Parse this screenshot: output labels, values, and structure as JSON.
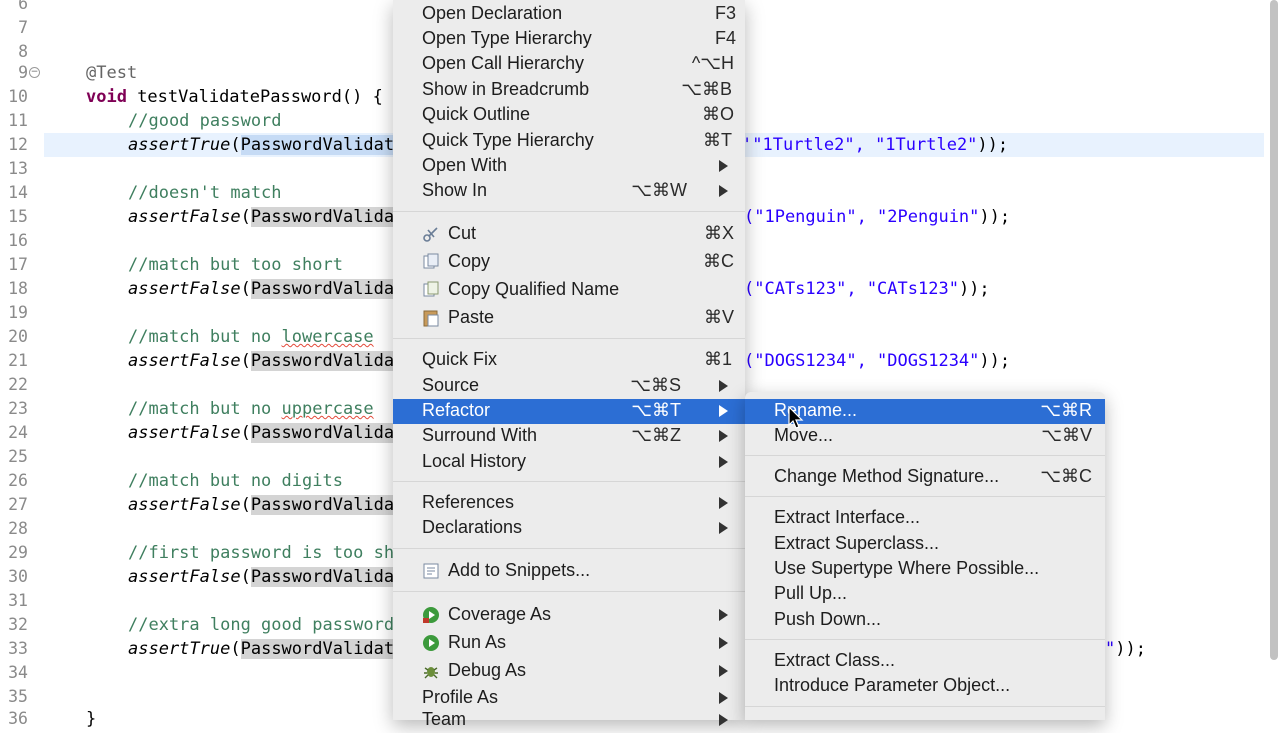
{
  "editor": {
    "lines": [
      {
        "num": "6"
      },
      {
        "num": "7"
      },
      {
        "num": "8"
      },
      {
        "num": "9",
        "annotation": "@Test"
      },
      {
        "num": "10",
        "kw": "void",
        "sig": " testValidatePassword() {"
      },
      {
        "num": "11",
        "comment": "//good password"
      },
      {
        "num": "12",
        "call": "assertTrue",
        "cls": "PasswordValidat",
        "tail_open": "(",
        "args": "\"1Turtle2\", \"1Turtle2\"",
        "end": "));"
      },
      {
        "num": "13"
      },
      {
        "num": "14",
        "comment": "//doesn't match"
      },
      {
        "num": "15",
        "call": "assertFalse",
        "cls": "PasswordValida",
        "args": "(\"1Penguin\", \"2Penguin\"",
        "end": "));"
      },
      {
        "num": "16"
      },
      {
        "num": "17",
        "comment": "//match but too short"
      },
      {
        "num": "18",
        "call": "assertFalse",
        "cls": "PasswordValida",
        "args": "(\"CATs123\", \"CATs123\"",
        "end": "));"
      },
      {
        "num": "19"
      },
      {
        "num": "20",
        "comment_a": "//match but no ",
        "comment_b": "lowercase"
      },
      {
        "num": "21",
        "call": "assertFalse",
        "cls": "PasswordValida",
        "args": "(\"DOGS1234\", \"DOGS1234\"",
        "end": "));"
      },
      {
        "num": "22"
      },
      {
        "num": "23",
        "comment_a": "//match but no ",
        "comment_b": "uppercase"
      },
      {
        "num": "24",
        "call": "assertFalse",
        "cls": "PasswordValida"
      },
      {
        "num": "25"
      },
      {
        "num": "26",
        "comment": "//match but no digits"
      },
      {
        "num": "27",
        "call": "assertFalse",
        "cls": "PasswordValida"
      },
      {
        "num": "28"
      },
      {
        "num": "29",
        "comment": "//first password is too sh"
      },
      {
        "num": "30",
        "call": "assertFalse",
        "cls": "PasswordValida"
      },
      {
        "num": "31"
      },
      {
        "num": "32",
        "comment": "//extra long good password"
      },
      {
        "num": "33",
        "call": "assertTrue",
        "cls": "PasswordValidat",
        "args": "\"",
        "end": "));"
      },
      {
        "num": "34"
      },
      {
        "num": "35"
      },
      {
        "num": "36",
        "brace": "}"
      }
    ]
  },
  "context_menu": {
    "items": [
      {
        "label": "Open Declaration",
        "shortcut": "F3"
      },
      {
        "label": "Open Type Hierarchy",
        "shortcut": "F4"
      },
      {
        "label": "Open Call Hierarchy",
        "shortcut": "^⌥H"
      },
      {
        "label": "Show in Breadcrumb",
        "shortcut": "⌥⌘B"
      },
      {
        "label": "Quick Outline",
        "shortcut": "⌘O"
      },
      {
        "label": "Quick Type Hierarchy",
        "shortcut": "⌘T"
      },
      {
        "label": "Open With"
      },
      {
        "label": "Show In",
        "shortcut": "⌥⌘W"
      },
      {
        "label": "Cut",
        "shortcut": "⌘X",
        "icon": "scissors-icon"
      },
      {
        "label": "Copy",
        "shortcut": "⌘C",
        "icon": "copy-icon"
      },
      {
        "label": "Copy Qualified Name",
        "icon": "copy-qualified-icon"
      },
      {
        "label": "Paste",
        "shortcut": "⌘V",
        "icon": "paste-icon"
      },
      {
        "label": "Quick Fix",
        "shortcut": "⌘1"
      },
      {
        "label": "Source",
        "shortcut": "⌥⌘S"
      },
      {
        "label": "Refactor",
        "shortcut": "⌥⌘T"
      },
      {
        "label": "Surround With",
        "shortcut": "⌥⌘Z"
      },
      {
        "label": "Local History"
      },
      {
        "label": "References"
      },
      {
        "label": "Declarations"
      },
      {
        "label": "Add to Snippets...",
        "icon": "snippets-icon"
      },
      {
        "label": "Coverage As",
        "icon": "coverage-icon"
      },
      {
        "label": "Run As",
        "icon": "run-icon"
      },
      {
        "label": "Debug As",
        "icon": "debug-icon"
      },
      {
        "label": "Profile As"
      },
      {
        "label": "Team"
      }
    ]
  },
  "refactor_submenu": {
    "items": [
      {
        "label": "Rename...",
        "shortcut": "⌥⌘R"
      },
      {
        "label": "Move...",
        "shortcut": "⌥⌘V"
      },
      {
        "label": "Change Method Signature...",
        "shortcut": "⌥⌘C"
      },
      {
        "label": "Extract Interface..."
      },
      {
        "label": "Extract Superclass..."
      },
      {
        "label": "Use Supertype Where Possible..."
      },
      {
        "label": "Pull Up..."
      },
      {
        "label": "Push Down..."
      },
      {
        "label": "Extract Class..."
      },
      {
        "label": "Introduce Parameter Object..."
      }
    ]
  },
  "colors": {
    "highlight": "#2c6ed4",
    "menu_bg": "#ececec",
    "keyword": "#7f0055",
    "comment": "#3f7f5f",
    "string": "#2a00ff"
  }
}
